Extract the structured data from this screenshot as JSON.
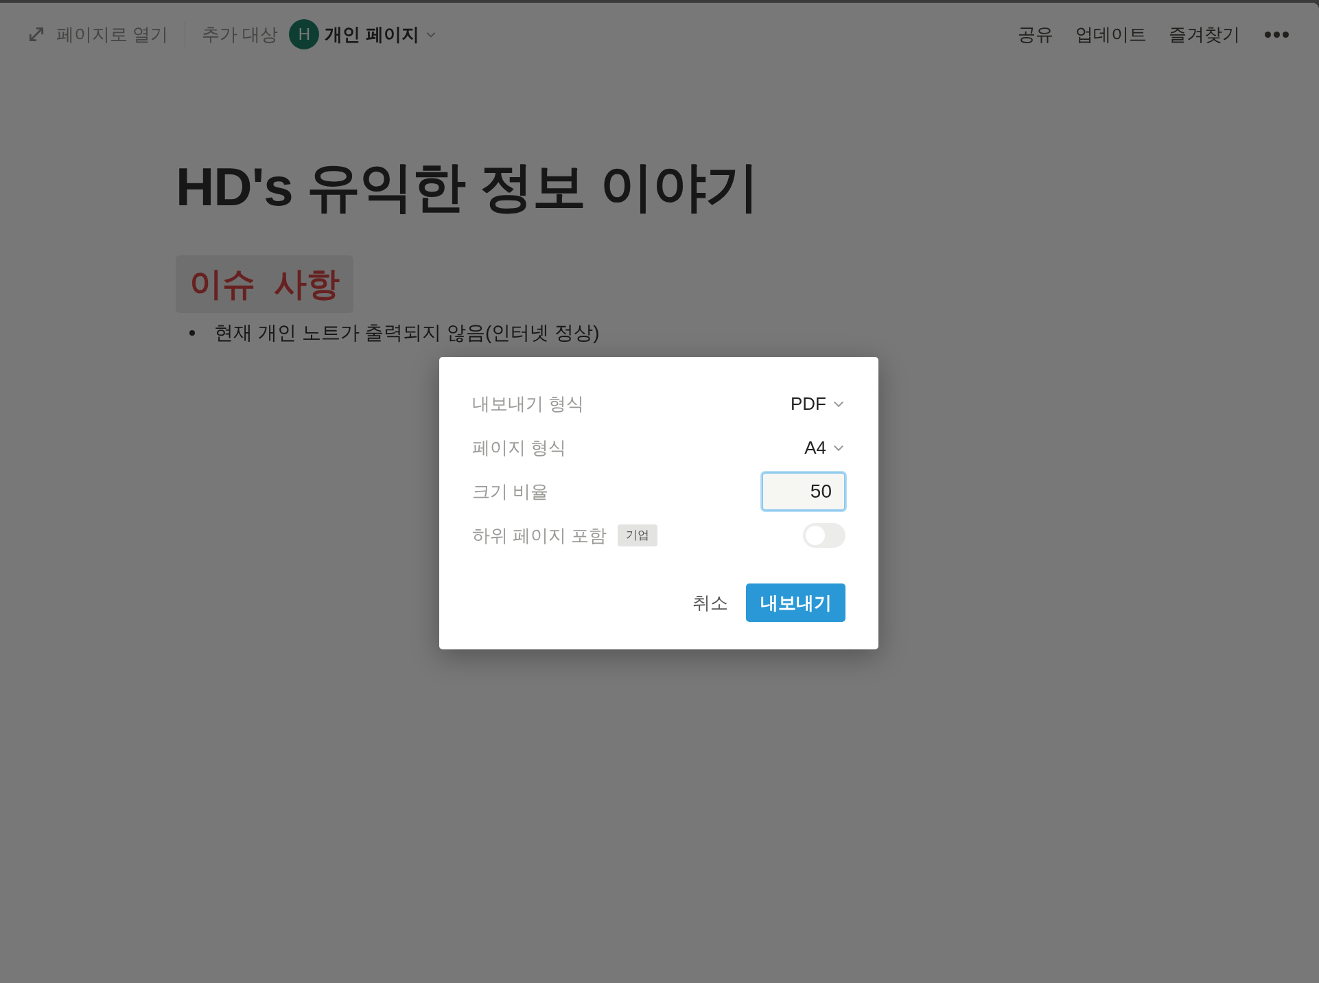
{
  "topbar": {
    "open_as_page": "페이지로 열기",
    "add_to": "추가 대상",
    "workspace": {
      "initial": "H",
      "name": "개인 페이지"
    },
    "actions": [
      "공유",
      "업데이트",
      "즐겨찾기"
    ]
  },
  "page": {
    "title": "HD's 유익한 정보 이야기",
    "heading": "이슈  사항",
    "bullets": [
      "현재 개인 노트가 출력되지 않음(인터넷 정상)"
    ]
  },
  "dialog": {
    "rows": [
      {
        "kind": "select",
        "label": "내보내기 형식",
        "value": "PDF"
      },
      {
        "kind": "select",
        "label": "페이지 형식",
        "value": "A4"
      },
      {
        "kind": "number",
        "label": "크기 비율",
        "value": "50"
      },
      {
        "kind": "toggle",
        "label": "하위 페이지 포함",
        "badge": "기업",
        "on": false
      }
    ],
    "cancel": "취소",
    "confirm": "내보내기"
  }
}
